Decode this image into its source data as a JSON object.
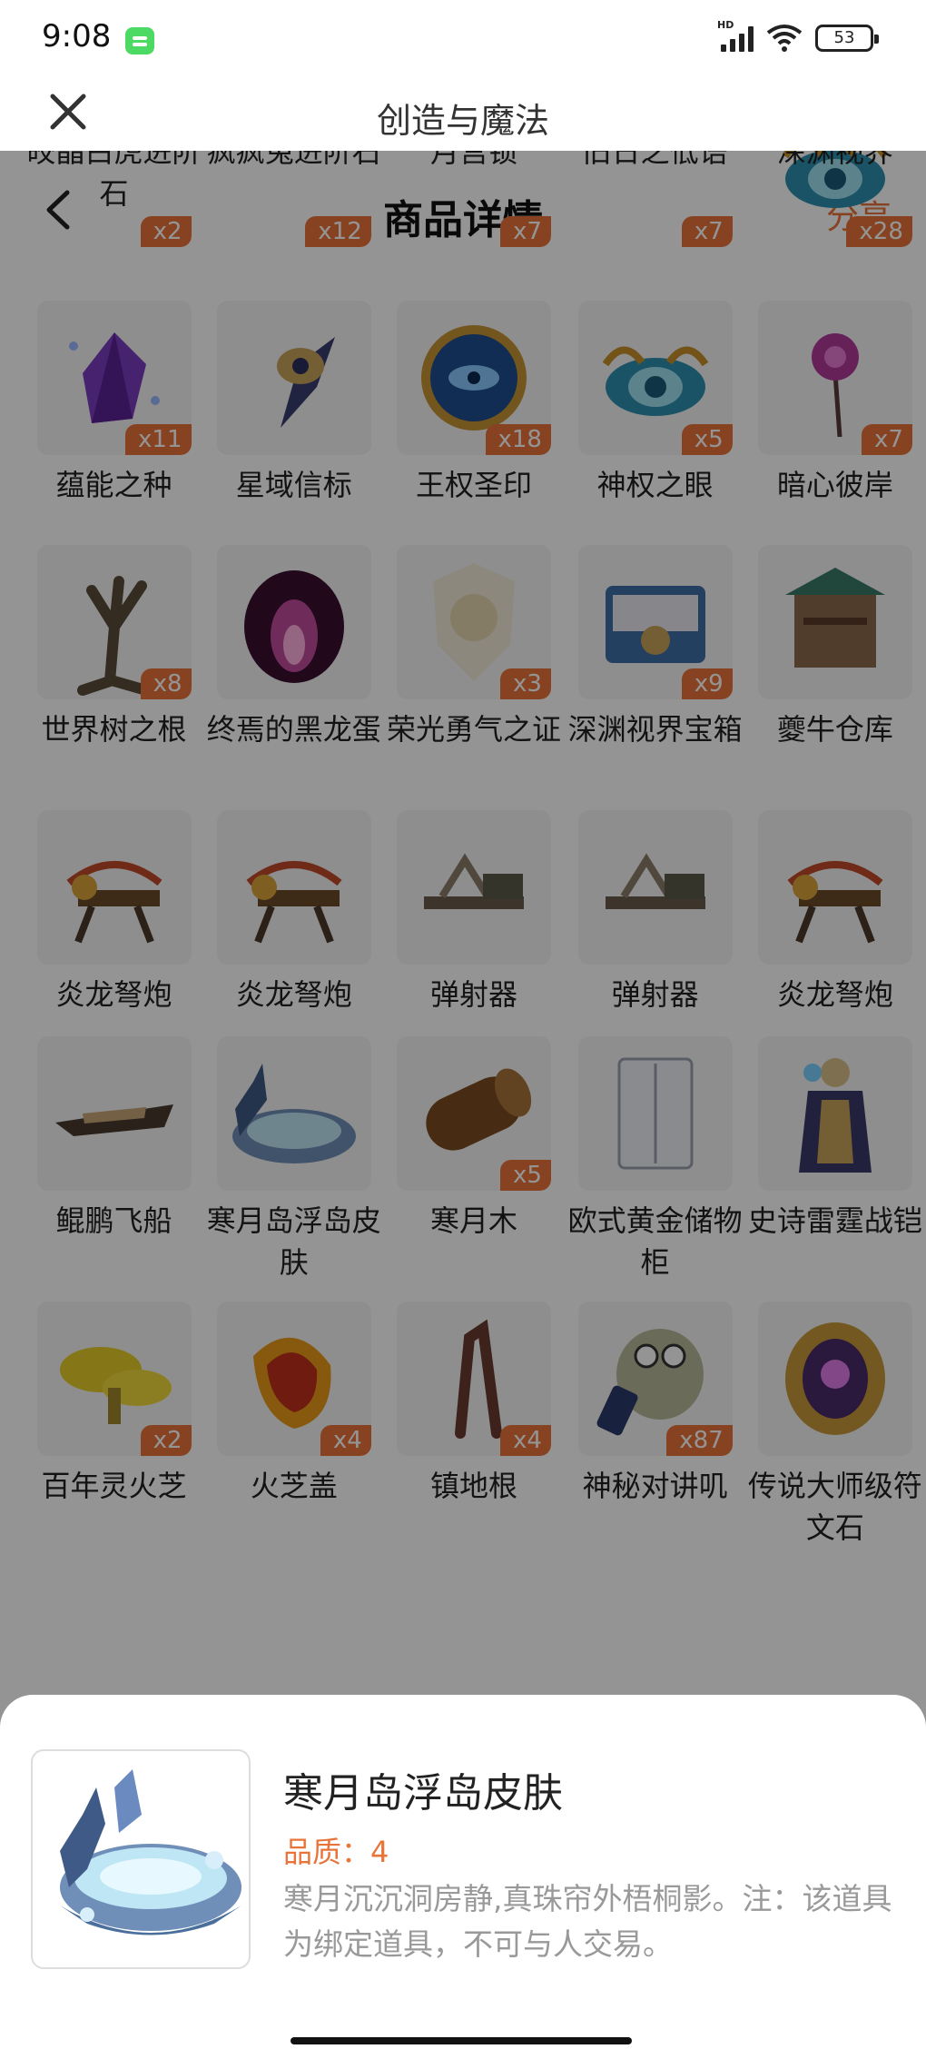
{
  "status_bar": {
    "time": "9:08",
    "network_label": "HD",
    "wifi_label": "6",
    "battery": "53"
  },
  "top_bar": {
    "title": "创造与魔法"
  },
  "nav": {
    "title": "商品详情",
    "share": "分享"
  },
  "items": [
    {
      "name": "皎晶白虎进阶石",
      "qty": "x2",
      "icon": "gem-icon"
    },
    {
      "name": "疯疯兔进阶石",
      "qty": "x12",
      "icon": "gem-icon"
    },
    {
      "name": "月宫锁",
      "qty": "x7",
      "icon": "lock-icon"
    },
    {
      "name": "旧日之低语",
      "qty": "x7",
      "icon": "scroll-icon"
    },
    {
      "name": "深渊视界",
      "qty": "x28",
      "icon": "eye-icon"
    },
    {
      "name": "蕴能之种",
      "qty": "x11",
      "icon": "crystal-icon"
    },
    {
      "name": "星域信标",
      "qty": "",
      "icon": "beacon-icon"
    },
    {
      "name": "王权圣印",
      "qty": "x18",
      "icon": "seal-icon"
    },
    {
      "name": "神权之眼",
      "qty": "x5",
      "icon": "eye-icon"
    },
    {
      "name": "暗心彼岸",
      "qty": "x7",
      "icon": "flower-icon"
    },
    {
      "name": "世界树之根",
      "qty": "x8",
      "icon": "tree-root-icon"
    },
    {
      "name": "终焉的黑龙蛋",
      "qty": "",
      "icon": "egg-icon"
    },
    {
      "name": "荣光勇气之证",
      "qty": "x3",
      "icon": "emblem-icon"
    },
    {
      "name": "深渊视界宝箱",
      "qty": "x9",
      "icon": "chest-icon"
    },
    {
      "name": "夔牛仓库",
      "qty": "",
      "icon": "warehouse-icon"
    },
    {
      "name": "炎龙弩炮",
      "qty": "",
      "icon": "ballista-icon"
    },
    {
      "name": "炎龙弩炮",
      "qty": "",
      "icon": "ballista-icon"
    },
    {
      "name": "弹射器",
      "qty": "",
      "icon": "catapult-icon"
    },
    {
      "name": "弹射器",
      "qty": "",
      "icon": "catapult-icon"
    },
    {
      "name": "炎龙弩炮",
      "qty": "",
      "icon": "ballista-icon"
    },
    {
      "name": "鲲鹏飞船",
      "qty": "",
      "icon": "airship-icon"
    },
    {
      "name": "寒月岛浮岛皮肤",
      "qty": "",
      "icon": "island-icon"
    },
    {
      "name": "寒月木",
      "qty": "x5",
      "icon": "log-icon"
    },
    {
      "name": "欧式黄金储物柜",
      "qty": "",
      "icon": "cabinet-icon"
    },
    {
      "name": "史诗雷霆战铠",
      "qty": "",
      "icon": "armor-icon"
    },
    {
      "name": "百年灵火芝",
      "qty": "x2",
      "icon": "mushroom-icon"
    },
    {
      "name": "火芝盖",
      "qty": "x4",
      "icon": "mushroom-cap-icon"
    },
    {
      "name": "镇地根",
      "qty": "x4",
      "icon": "root-icon"
    },
    {
      "name": "神秘对讲叽",
      "qty": "x87",
      "icon": "walkie-talkie-icon"
    },
    {
      "name": "传说大师级符文石",
      "qty": "",
      "icon": "rune-stone-icon"
    }
  ],
  "detail": {
    "name": "寒月岛浮岛皮肤",
    "quality": "品质：4",
    "description": "寒月沉沉洞房静,真珠帘外梧桐影。注：该道具为绑定道具，不可与人交易。"
  },
  "colors": {
    "accent": "#e8743a",
    "overlay": "rgba(0,0,0,0.42)"
  }
}
